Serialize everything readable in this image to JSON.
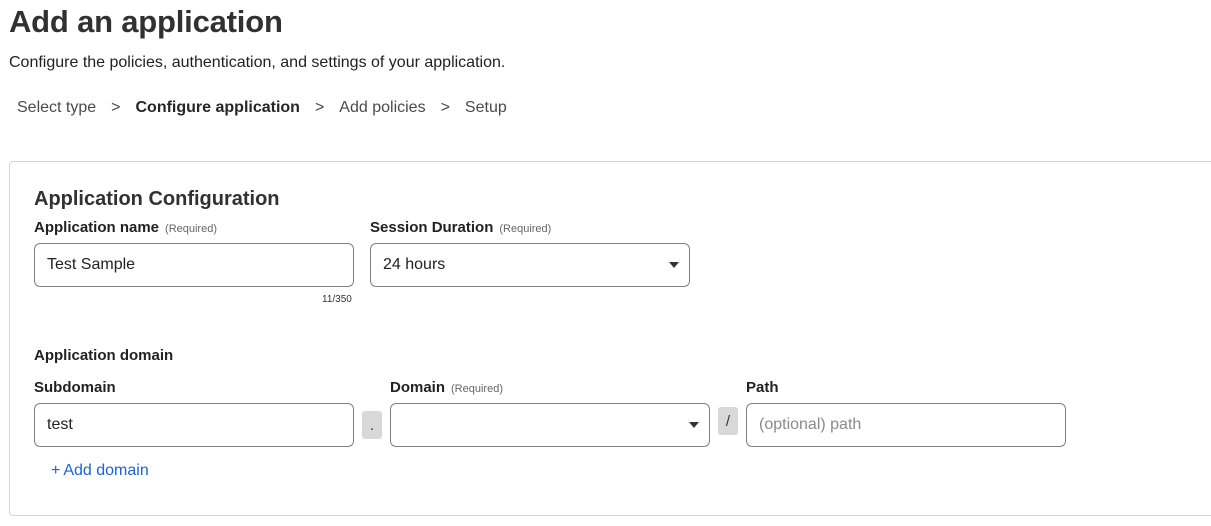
{
  "page": {
    "title": "Add an application",
    "subtitle": "Configure the policies, authentication, and settings of your application."
  },
  "breadcrumb": {
    "steps": [
      {
        "label": "Select type",
        "active": false
      },
      {
        "label": "Configure application",
        "active": true
      },
      {
        "label": "Add policies",
        "active": false
      },
      {
        "label": "Setup",
        "active": false
      }
    ],
    "separator": ">"
  },
  "config": {
    "title": "Application Configuration",
    "app_name": {
      "label": "Application name",
      "required": "(Required)",
      "value": "Test Sample",
      "counter": "11/350"
    },
    "session_duration": {
      "label": "Session Duration",
      "required": "(Required)",
      "value": "24 hours"
    },
    "domain_section": {
      "label": "Application domain",
      "subdomain": {
        "label": "Subdomain",
        "value": "test"
      },
      "dot": ".",
      "domain": {
        "label": "Domain",
        "required": "(Required)",
        "value": ""
      },
      "slash": "/",
      "path": {
        "label": "Path",
        "placeholder": "(optional) path",
        "value": ""
      },
      "add_domain": {
        "icon": "+",
        "label": "Add domain"
      }
    }
  },
  "colors": {
    "link": "#1a64d6",
    "border": "#808080",
    "card_border": "#d5d5d5"
  }
}
